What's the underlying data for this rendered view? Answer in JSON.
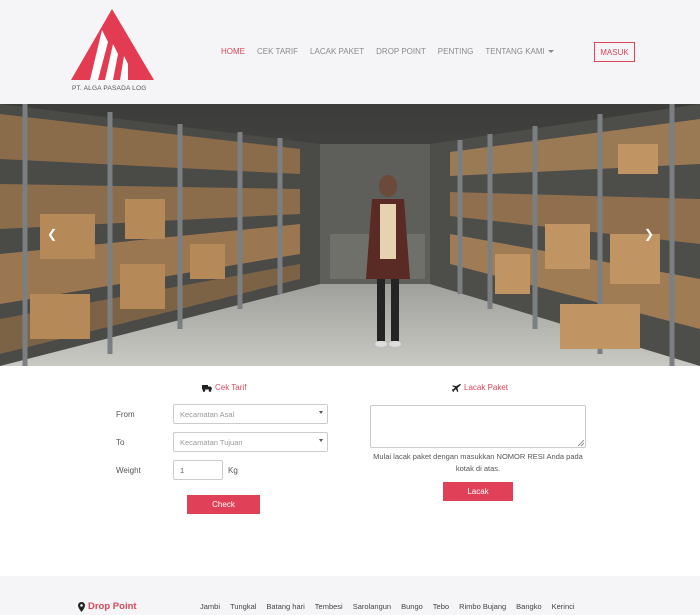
{
  "brand": {
    "company": "PT. ALGA PASADA LOG",
    "accent": "#d9475a"
  },
  "nav": {
    "items": [
      {
        "label": "HOME",
        "active": true
      },
      {
        "label": "CEK TARIF",
        "active": false
      },
      {
        "label": "LACAK PAKET",
        "active": false
      },
      {
        "label": "DROP POINT",
        "active": false
      },
      {
        "label": "PENTING",
        "active": false
      },
      {
        "label": "TENTANG KAMI",
        "active": false,
        "dropdown": true
      }
    ],
    "login_label": "MASUK"
  },
  "hero": {
    "prev_icon": "chevron-left-icon",
    "next_icon": "chevron-right-icon"
  },
  "cek_tarif": {
    "title": "Cek Tarif",
    "icon": "truck-icon",
    "from_label": "From",
    "from_placeholder": "Kecamatan Asal",
    "to_label": "To",
    "to_placeholder": "Kecamatan Tujuan",
    "weight_label": "Weight",
    "weight_value": "1",
    "weight_unit": "Kg",
    "button_label": "Check"
  },
  "lacak_paket": {
    "title": "Lacak Paket",
    "icon": "plane-icon",
    "help_text": "Mulai lacak paket dengan masukkan NOMOR RESI Anda pada kotak di atas.",
    "button_label": "Lacak"
  },
  "footer": {
    "drop_point_title": "Drop Point",
    "icon": "map-marker-icon",
    "locations": [
      "Jambi",
      "Tungkal",
      "Batang hari",
      "Tembesi",
      "Sarolangun",
      "Bungo",
      "Tebo",
      "Rimbo Bujang",
      "Bangko",
      "Kerinci"
    ]
  }
}
